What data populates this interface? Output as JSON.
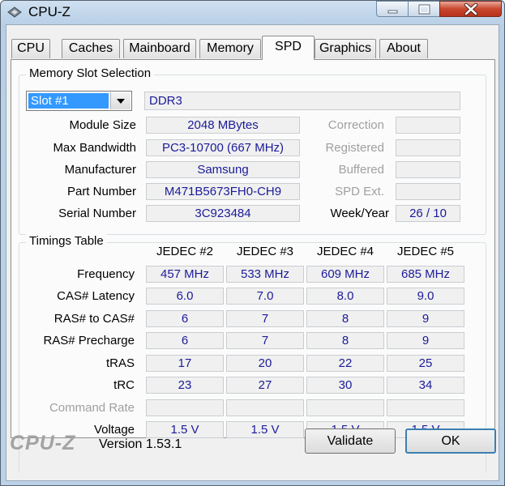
{
  "window": {
    "title": "CPU-Z"
  },
  "tabs": [
    "CPU",
    "Caches",
    "Mainboard",
    "Memory",
    "SPD",
    "Graphics",
    "About"
  ],
  "active_tab": "SPD",
  "memory_slot": {
    "group_title": "Memory Slot Selection",
    "selected_slot": "Slot #1",
    "type": "DDR3",
    "labels": {
      "module_size": "Module Size",
      "max_bandwidth": "Max Bandwidth",
      "manufacturer": "Manufacturer",
      "part_number": "Part Number",
      "serial_number": "Serial Number",
      "correction": "Correction",
      "registered": "Registered",
      "buffered": "Buffered",
      "spd_ext": "SPD Ext.",
      "week_year": "Week/Year"
    },
    "values": {
      "module_size": "2048 MBytes",
      "max_bandwidth": "PC3-10700 (667 MHz)",
      "manufacturer": "Samsung",
      "part_number": "M471B5673FH0-CH9",
      "serial_number": "3C923484",
      "correction": "",
      "registered": "",
      "buffered": "",
      "spd_ext": "",
      "week_year": "26 / 10"
    }
  },
  "timings": {
    "group_title": "Timings Table",
    "columns": [
      "JEDEC #2",
      "JEDEC #3",
      "JEDEC #4",
      "JEDEC #5"
    ],
    "rows": [
      {
        "label": "Frequency",
        "values": [
          "457 MHz",
          "533 MHz",
          "609 MHz",
          "685 MHz"
        ]
      },
      {
        "label": "CAS# Latency",
        "values": [
          "6.0",
          "7.0",
          "8.0",
          "9.0"
        ]
      },
      {
        "label": "RAS# to CAS#",
        "values": [
          "6",
          "7",
          "8",
          "9"
        ]
      },
      {
        "label": "RAS# Precharge",
        "values": [
          "6",
          "7",
          "8",
          "9"
        ]
      },
      {
        "label": "tRAS",
        "values": [
          "17",
          "20",
          "22",
          "25"
        ]
      },
      {
        "label": "tRC",
        "values": [
          "23",
          "27",
          "30",
          "34"
        ]
      },
      {
        "label": "Command Rate",
        "values": [
          "",
          "",
          "",
          ""
        ]
      },
      {
        "label": "Voltage",
        "values": [
          "1.5 V",
          "1.5 V",
          "1.5 V",
          "1.5 V"
        ]
      }
    ]
  },
  "footer": {
    "logo": "CPU-Z",
    "version": "Version 1.53.1",
    "validate_label": "Validate",
    "ok_label": "OK"
  }
}
